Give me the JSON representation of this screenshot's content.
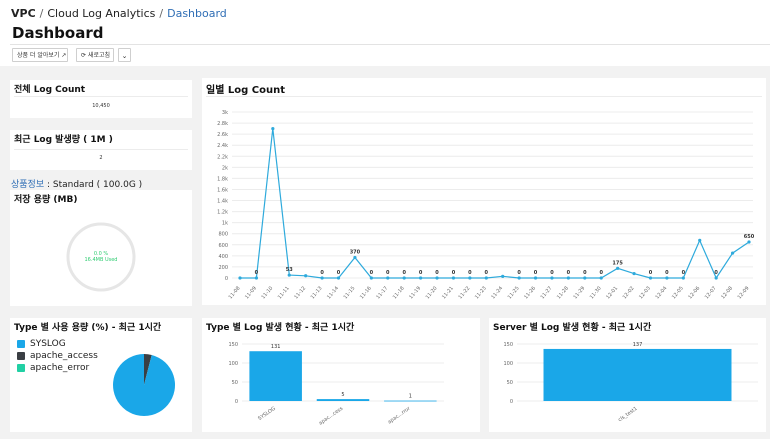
{
  "breadcrumb": {
    "root": "VPC",
    "section": "Cloud Log Analytics",
    "current": "Dashboard"
  },
  "page_title": "Dashboard",
  "toolbar": {
    "more_label": "상품 더 알아보기",
    "refresh_label": "새로고침"
  },
  "icons": {
    "external": "external-link-icon",
    "refresh": "refresh-icon",
    "chevron": "chevron-down-icon"
  },
  "total_log": {
    "title": "전체 Log Count",
    "value": "10,450"
  },
  "recent_log": {
    "title": "최근 Log 발생량 ( 1M )",
    "value": "2"
  },
  "product_info": {
    "link_label": "상품정보",
    "text": " : Standard ( 100.0G )"
  },
  "storage": {
    "title": "저장 용량 (MB)",
    "percent_text": "0.0 %",
    "used_text": "16.4MB Used",
    "percent_value": 0.0
  },
  "daily": {
    "title": "일별 Log Count",
    "chart_data": {
      "type": "line",
      "x": [
        "11-08",
        "11-09",
        "11-10",
        "11-11",
        "11-12",
        "11-13",
        "11-14",
        "11-15",
        "11-16",
        "11-17",
        "11-18",
        "11-19",
        "11-20",
        "11-21",
        "11-22",
        "11-23",
        "11-24",
        "11-25",
        "11-26",
        "11-27",
        "11-28",
        "11-29",
        "11-30",
        "12-01",
        "12-02",
        "12-03",
        "12-04",
        "12-05",
        "12-06",
        "12-07",
        "12-08",
        "12-09"
      ],
      "values": [
        0,
        0,
        2700,
        53,
        40,
        0,
        0,
        370,
        0,
        0,
        0,
        0,
        0,
        0,
        0,
        0,
        30,
        0,
        0,
        0,
        0,
        0,
        0,
        175,
        80,
        0,
        0,
        0,
        680,
        0,
        450,
        650
      ],
      "data_labels": [
        "",
        "0",
        "",
        "53",
        "",
        "0",
        "0",
        "370",
        "0",
        "0",
        "0",
        "0",
        "0",
        "0",
        "0",
        "0",
        "",
        "0",
        "0",
        "0",
        "0",
        "0",
        "0",
        "175",
        "",
        "0",
        "0",
        "0",
        "",
        "0",
        "",
        "650"
      ],
      "y_ticks": [
        0,
        200,
        400,
        600,
        800,
        "1k",
        "1.2k",
        "1.4k",
        "1.6k",
        "1.8k",
        "2k",
        "2.2k",
        "2.4k",
        "2.6k",
        "2.8k",
        "3k"
      ],
      "ylim": [
        0,
        3000
      ],
      "color": "#2eaadc",
      "grid": true,
      "xlabel": "",
      "ylabel": ""
    }
  },
  "type_usage": {
    "title": "Type 별 사용 용량 (%) - 최근 1시간",
    "chart_data": {
      "type": "pie",
      "labels": [
        "SYSLOG",
        "apache_access",
        "apache_error"
      ],
      "values": [
        96,
        4,
        0
      ],
      "colors": [
        "#1aa7e8",
        "#3a3f44",
        "#21d0a4"
      ]
    }
  },
  "type_count": {
    "title": "Type 별 Log 발생 현황 - 최근 1시간",
    "chart_data": {
      "type": "bar",
      "categories": [
        "SYSLOG",
        "apac...cess",
        "apac...rror"
      ],
      "values": [
        131,
        5,
        1
      ],
      "ylim": [
        0,
        150
      ],
      "y_ticks": [
        0,
        50,
        100,
        150
      ],
      "color": "#1aa7e8",
      "grid": true,
      "xlabel": "",
      "ylabel": ""
    }
  },
  "server_count": {
    "title": "Server 별 Log 발생 현황 - 최근 1시간",
    "chart_data": {
      "type": "bar",
      "categories": [
        "cls_test1"
      ],
      "values": [
        137
      ],
      "ylim": [
        0,
        150
      ],
      "y_ticks": [
        0,
        50,
        100,
        150
      ],
      "color": "#1aa7e8",
      "grid": true,
      "xlabel": "",
      "ylabel": ""
    }
  }
}
